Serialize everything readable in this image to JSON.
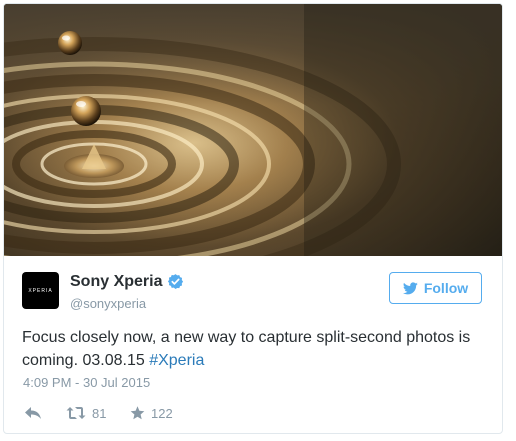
{
  "tweet": {
    "author": {
      "display_name": "Sony Xperia",
      "handle": "@sonyxperia",
      "avatar_text": "XPERIA",
      "verified": true
    },
    "follow_button": {
      "label": "Follow",
      "icon": "twitter-bird-icon"
    },
    "text": {
      "body": "Focus closely now, a new way to capture split-second photos is coming. 03.08.15 ",
      "hashtag": "#Xperia"
    },
    "timestamp": "4:09 PM - 30 Jul 2015",
    "actions": {
      "reply_icon": "reply-icon",
      "retweet_icon": "retweet-icon",
      "retweet_count": "81",
      "favorite_icon": "star-icon",
      "favorite_count": "122"
    },
    "media": {
      "description_icon": "water-drop-image"
    }
  },
  "colors": {
    "accent": "#55acee",
    "hashtag": "#2b7bb9",
    "text": "#292f33",
    "muted": "#8899a6",
    "verified": "#55acee"
  }
}
